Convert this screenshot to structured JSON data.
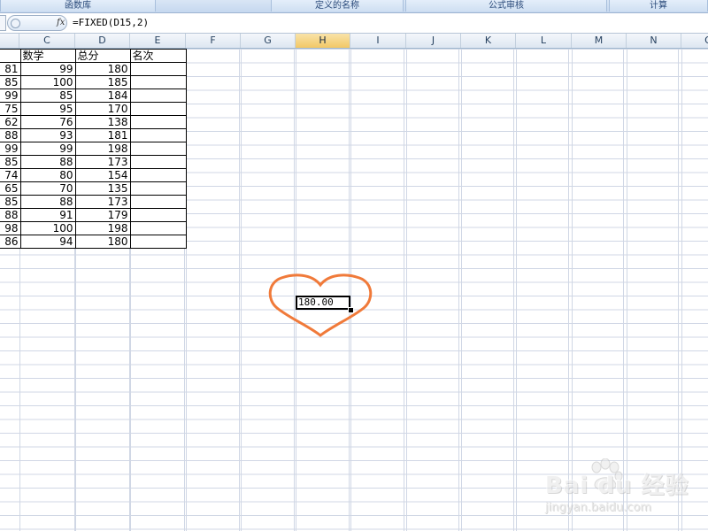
{
  "ribbon": {
    "groups": [
      {
        "label": "函数库"
      },
      {
        "label": "定义的名称"
      },
      {
        "label": "公式审核"
      },
      {
        "label": "计算"
      }
    ]
  },
  "formula_bar": {
    "fx_label": "fx",
    "formula": "=FIXED(D15,2)"
  },
  "columns": [
    "C",
    "D",
    "E",
    "F",
    "G",
    "H",
    "I",
    "J",
    "K",
    "L",
    "M",
    "N",
    "O"
  ],
  "selected_column": "H",
  "table": {
    "header": {
      "b": "",
      "c": "数学",
      "d": "总分",
      "e": "名次"
    },
    "rows": [
      {
        "b": "81",
        "c": "99",
        "d": "180"
      },
      {
        "b": "85",
        "c": "100",
        "d": "185"
      },
      {
        "b": "99",
        "c": "85",
        "d": "184"
      },
      {
        "b": "75",
        "c": "95",
        "d": "170"
      },
      {
        "b": "62",
        "c": "76",
        "d": "138"
      },
      {
        "b": "88",
        "c": "93",
        "d": "181"
      },
      {
        "b": "99",
        "c": "99",
        "d": "198"
      },
      {
        "b": "85",
        "c": "88",
        "d": "173"
      },
      {
        "b": "74",
        "c": "80",
        "d": "154"
      },
      {
        "b": "65",
        "c": "70",
        "d": "135"
      },
      {
        "b": "85",
        "c": "88",
        "d": "173"
      },
      {
        "b": "88",
        "c": "91",
        "d": "179"
      },
      {
        "b": "98",
        "c": "100",
        "d": "198"
      },
      {
        "b": "86",
        "c": "94",
        "d": "180"
      }
    ]
  },
  "active_cell": {
    "value": "180.00"
  },
  "heart_color": "#f07a3a",
  "watermark": {
    "logo": "Bai du 经验",
    "sub": "jingyan.baidu.com"
  }
}
